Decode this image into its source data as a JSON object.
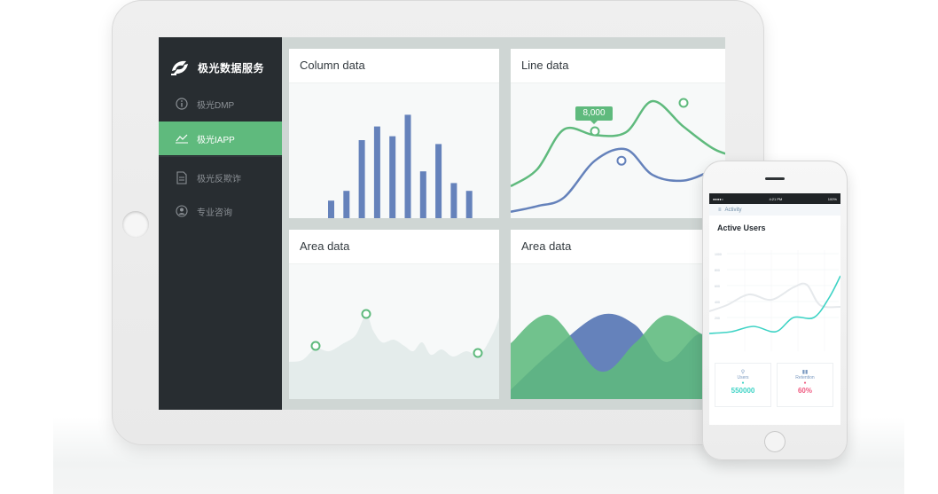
{
  "app": {
    "brand": "极光数据服务",
    "colors": {
      "sidebar": "#282d31",
      "accent_green": "#5fba7d",
      "series_blue": "#6582bb",
      "phone_cyan": "#3ed3c5",
      "phone_pink": "#ef5a80"
    }
  },
  "sidebar": {
    "items": [
      {
        "label": "极光DMP",
        "icon": "info-icon",
        "active": false
      },
      {
        "label": "极光IAPP",
        "icon": "line-chart-icon",
        "active": true
      },
      {
        "label": "极光反欺诈",
        "icon": "document-icon",
        "active": false
      },
      {
        "label": "专业咨询",
        "icon": "user-icon",
        "active": false
      }
    ]
  },
  "cards": {
    "column": {
      "title": "Column data"
    },
    "line": {
      "title": "Line data",
      "tooltip": "8,000"
    },
    "area1": {
      "title": "Area data"
    },
    "area2": {
      "title": "Area data"
    }
  },
  "chart_data": [
    {
      "type": "bar",
      "values": [
        9,
        14,
        40,
        47,
        42,
        53,
        24,
        38,
        18,
        14
      ],
      "ylim": [
        0,
        60
      ]
    },
    {
      "type": "line",
      "series": [
        {
          "color": "#5fba7d",
          "values": [
            2,
            3.2,
            6.0,
            5.6,
            5.8,
            8.0,
            6.2,
            4.6,
            4.0
          ]
        },
        {
          "color": "#6582bb",
          "values": [
            0.2,
            0.6,
            1.2,
            3.8,
            4.6,
            2.8,
            2.4,
            3.2,
            4.0
          ]
        }
      ]
    },
    {
      "type": "area",
      "highlighted_points": 3
    },
    {
      "type": "area",
      "series": [
        {
          "color": "#6582bb",
          "values": [
            1,
            5,
            9,
            8,
            4,
            7,
            3
          ]
        },
        {
          "color": "#5fba7d",
          "values": [
            6,
            9,
            3,
            6,
            9,
            7,
            5
          ]
        }
      ]
    }
  ],
  "phone": {
    "status_time": "4:21 PM",
    "status_battery": "100%",
    "nav_label": "Activity",
    "title": "Active Users",
    "y_ticks": [
      "1000",
      "800",
      "600",
      "400",
      "200"
    ],
    "stats": [
      {
        "label": "Users",
        "value": "550000",
        "color": "#3ed3c5"
      },
      {
        "label": "Retention",
        "value": "60%",
        "color": "#ef5a80"
      }
    ]
  }
}
